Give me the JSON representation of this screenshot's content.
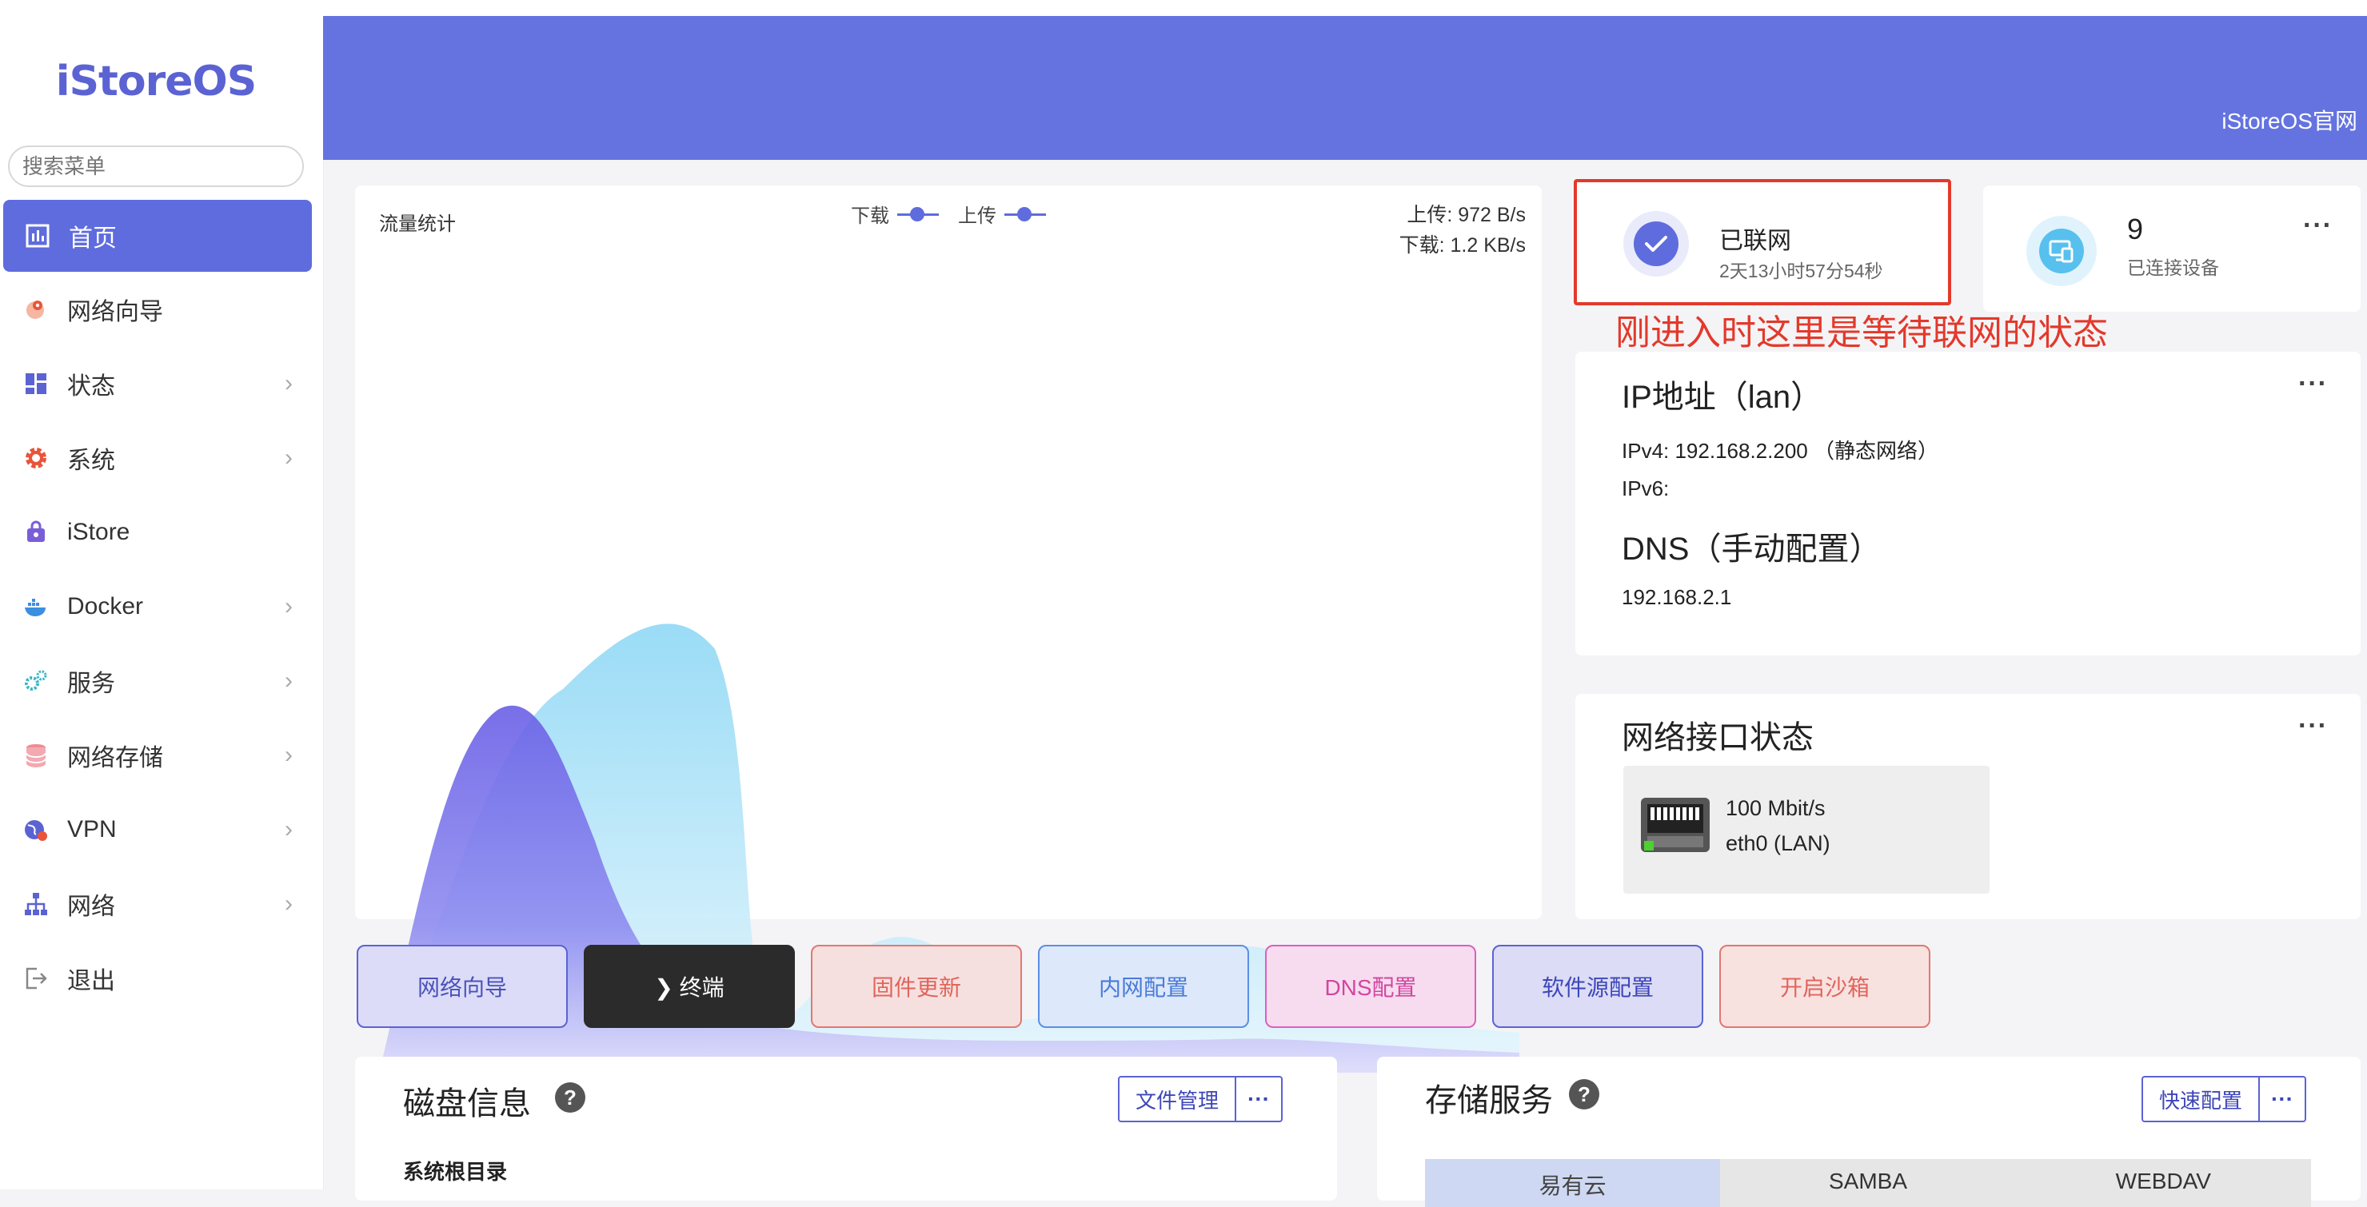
{
  "app": {
    "logo": "iStoreOS"
  },
  "search": {
    "placeholder": "搜索菜单"
  },
  "sidebar": {
    "items": [
      {
        "label": "首页",
        "icon": "dashboard-icon",
        "active": true,
        "has_arrow": false
      },
      {
        "label": "网络向导",
        "icon": "globe-pin-icon",
        "active": false,
        "has_arrow": false
      },
      {
        "label": "状态",
        "icon": "grid-icon",
        "active": false,
        "has_arrow": true
      },
      {
        "label": "系统",
        "icon": "gear-icon",
        "active": false,
        "has_arrow": true
      },
      {
        "label": "iStore",
        "icon": "store-bag-icon",
        "active": false,
        "has_arrow": false
      },
      {
        "label": "Docker",
        "icon": "docker-whale-icon",
        "active": false,
        "has_arrow": true
      },
      {
        "label": "服务",
        "icon": "cogs-icon",
        "active": false,
        "has_arrow": true
      },
      {
        "label": "网络存储",
        "icon": "database-icon",
        "active": false,
        "has_arrow": true
      },
      {
        "label": "VPN",
        "icon": "vpn-globe-icon",
        "active": false,
        "has_arrow": true
      },
      {
        "label": "网络",
        "icon": "network-tree-icon",
        "active": false,
        "has_arrow": true
      },
      {
        "label": "退出",
        "icon": "logout-icon",
        "active": false,
        "has_arrow": false
      }
    ],
    "arrow_glyph": "›"
  },
  "header": {
    "link": "iStoreOS官网"
  },
  "traffic": {
    "title": "流量统计",
    "legend_download": "下载",
    "legend_upload": "上传",
    "upload_rate": "上传: 972 B/s",
    "download_rate": "下载: 1.2 KB/s"
  },
  "network_status": {
    "title": "已联网",
    "uptime": "2天13小时57分54秒",
    "annotation": "刚进入时这里是等待联网的状态"
  },
  "devices": {
    "count": "9",
    "label": "已连接设备",
    "more": "···"
  },
  "ip_info": {
    "title": "IP地址（lan）",
    "ipv4": "IPv4:   192.168.2.200 （静态网络）",
    "ipv6": "IPv6:",
    "dns_title": "DNS（手动配置）",
    "dns": "192.168.2.1",
    "more": "···"
  },
  "interfaces": {
    "title": "网络接口状态",
    "more": "···",
    "ports": [
      {
        "speed": "100 Mbit/s",
        "name": "eth0 (LAN)"
      }
    ]
  },
  "quick_buttons": [
    {
      "label": "网络向导",
      "bg": "#dcdcf9",
      "border": "#5b63d3",
      "color": "#4b52b8"
    },
    {
      "label": "❯ 终端",
      "bg": "#2b2b2b",
      "border": "#2b2b2b",
      "color": "#ffffff"
    },
    {
      "label": "固件更新",
      "bg": "#f6e0df",
      "border": "#e3776f",
      "color": "#e0655c"
    },
    {
      "label": "内网配置",
      "bg": "#dde8fb",
      "border": "#5c8ee6",
      "color": "#4a7bd6"
    },
    {
      "label": "DNS配置",
      "bg": "#f7dcf0",
      "border": "#dd5fbf",
      "color": "#d2469f"
    },
    {
      "label": "软件源配置",
      "bg": "#dcdcf6",
      "border": "#5b63d3",
      "color": "#3d46b8"
    },
    {
      "label": "开启沙箱",
      "bg": "#f8e2e0",
      "border": "#e3776f",
      "color": "#e0655c"
    }
  ],
  "disk": {
    "title": "磁盘信息",
    "help": "?",
    "button": "文件管理",
    "more": "···",
    "root_label": "系统根目录"
  },
  "storage": {
    "title": "存储服务",
    "help": "?",
    "button": "快速配置",
    "more": "···",
    "tabs": [
      {
        "label": "易有云",
        "active": true
      },
      {
        "label": "SAMBA",
        "active": false
      },
      {
        "label": "WEBDAV",
        "active": false
      }
    ]
  },
  "colors": {
    "accent": "#5f6cde",
    "header": "#6473e0",
    "alert": "#e3392b",
    "download_fill": "#5f6cde",
    "upload_fill": "#8fd8f5"
  }
}
